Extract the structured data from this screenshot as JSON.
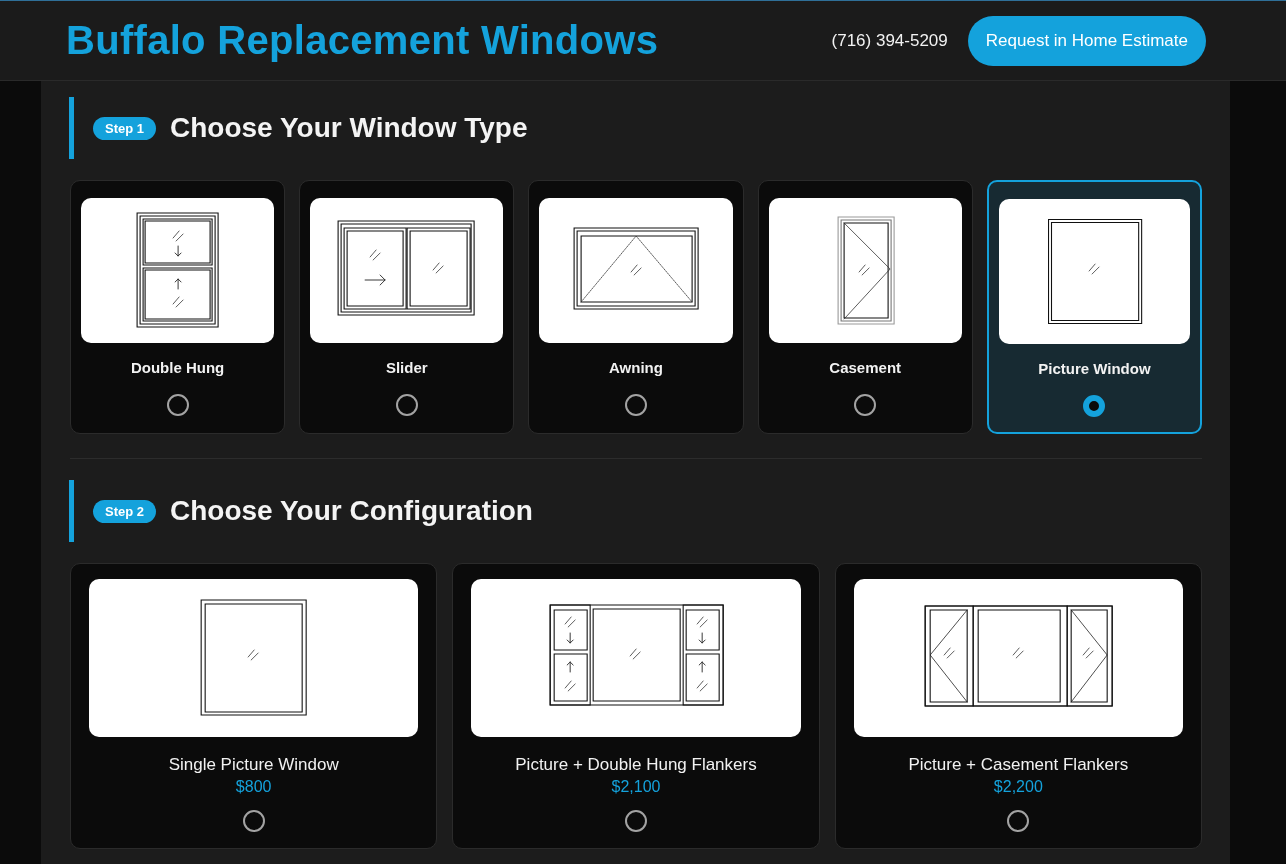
{
  "header": {
    "logo": "Buffalo Replacement Windows",
    "phone": "(716) 394-5209",
    "cta_button": "Request in Home Estimate"
  },
  "steps": [
    {
      "badge": "Step 1",
      "title": "Choose Your Window Type",
      "options": [
        {
          "kind": "double-hung",
          "label": "Double Hung",
          "selected": false
        },
        {
          "kind": "slider",
          "label": "Slider",
          "selected": false
        },
        {
          "kind": "awning",
          "label": "Awning",
          "selected": false
        },
        {
          "kind": "casement",
          "label": "Casement",
          "selected": false
        },
        {
          "kind": "picture",
          "label": "Picture Window",
          "selected": true
        }
      ]
    },
    {
      "badge": "Step 2",
      "title": "Choose Your Configuration",
      "options": [
        {
          "kind": "single-picture",
          "label": "Single Picture Window",
          "price": "$800",
          "selected": false
        },
        {
          "kind": "double-hung-flankers",
          "label": "Picture + Double Hung Flankers",
          "price": "$2,100",
          "selected": false
        },
        {
          "kind": "casement-flankers",
          "label": "Picture + Casement Flankers",
          "price": "$2,200",
          "selected": false
        }
      ]
    }
  ]
}
